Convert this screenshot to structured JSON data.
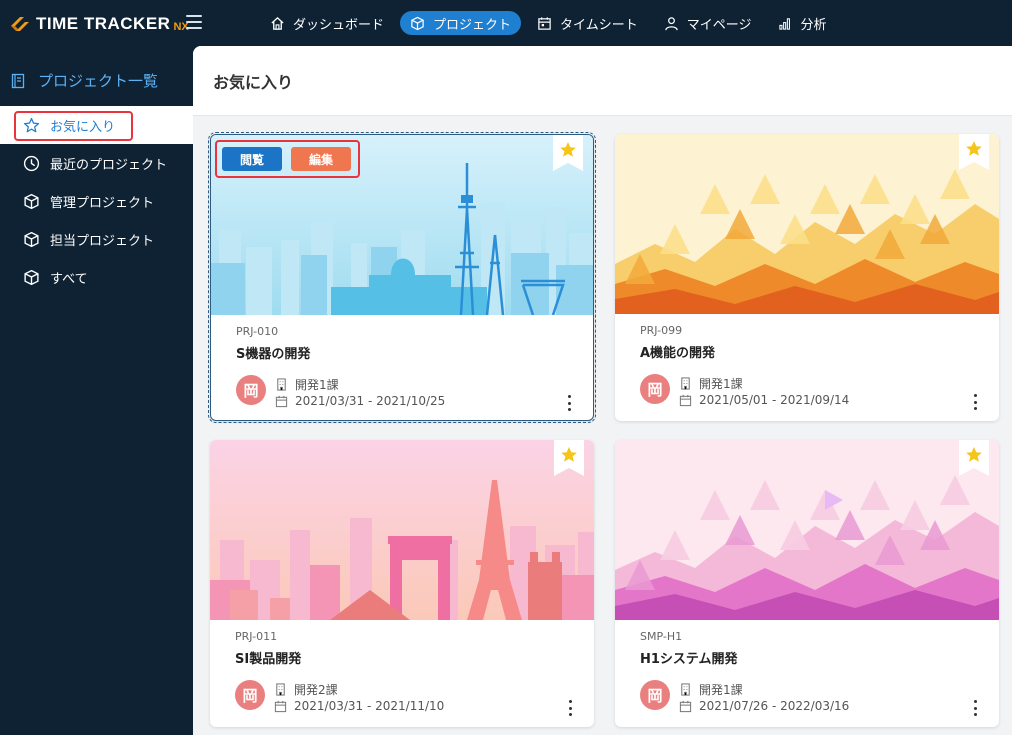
{
  "app": {
    "logo_text": "TIME TRACKER",
    "logo_suffix": "NX"
  },
  "nav": {
    "items": [
      {
        "label": "ダッシュボード",
        "icon": "home-icon"
      },
      {
        "label": "プロジェクト",
        "icon": "cube-icon",
        "active": true
      },
      {
        "label": "タイムシート",
        "icon": "calendar-icon"
      },
      {
        "label": "マイページ",
        "icon": "user-icon"
      },
      {
        "label": "分析",
        "icon": "chart-icon"
      }
    ]
  },
  "sidebar": {
    "header": "プロジェクト一覧",
    "items": [
      {
        "label": "お気に入り",
        "icon": "star-icon",
        "active": true
      },
      {
        "label": "最近のプロジェクト",
        "icon": "clock-icon"
      },
      {
        "label": "管理プロジェクト",
        "icon": "cube-icon"
      },
      {
        "label": "担当プロジェクト",
        "icon": "cube-icon"
      },
      {
        "label": "すべて",
        "icon": "cube-icon"
      }
    ]
  },
  "main": {
    "title": "お気に入り"
  },
  "card_actions": {
    "view": "閲覧",
    "edit": "編集"
  },
  "projects": [
    {
      "code": "PRJ-010",
      "name": "S機器の開発",
      "avatar": "岡",
      "dept": "開発1課",
      "period": "2021/03/31 - 2021/10/25",
      "theme": "tokyo"
    },
    {
      "code": "PRJ-099",
      "name": "A機能の開発",
      "avatar": "岡",
      "dept": "開発1課",
      "period": "2021/05/01 - 2021/09/14",
      "theme": "orange-triangles"
    },
    {
      "code": "PRJ-011",
      "name": "SI製品開発",
      "avatar": "岡",
      "dept": "開発2課",
      "period": "2021/03/31 - 2021/11/10",
      "theme": "paris"
    },
    {
      "code": "SMP-H1",
      "name": "H1システム開発",
      "avatar": "岡",
      "dept": "開発1課",
      "period": "2021/07/26 - 2022/03/16",
      "theme": "pink-triangles"
    }
  ],
  "colors": {
    "navy": "#0f2233",
    "accent_blue": "#1f7fd1",
    "edit_orange": "#f0764f",
    "favorite_gold": "#f5c518",
    "highlight_red": "#e8353d"
  }
}
